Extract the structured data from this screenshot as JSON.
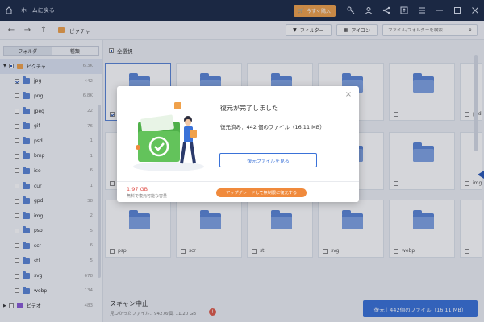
{
  "titlebar": {
    "home_label": "ホームに戻る",
    "buy_label": "今すぐ購入",
    "icons": [
      "cart-icon",
      "key-icon",
      "account-icon",
      "share-icon",
      "export-icon",
      "menu-icon",
      "minimize-icon",
      "maximize-icon",
      "close-icon"
    ]
  },
  "navbar": {
    "breadcrumb": "ピクチャ",
    "filter_label": "フィルター",
    "icon_view_label": "アイコン",
    "search_placeholder": "ファイル/フォルダーを検索"
  },
  "sidebar": {
    "tab_folder": "フォルダ",
    "tab_type": "種類",
    "root": {
      "label": "ピクチャ",
      "count": "6.3K"
    },
    "items": [
      {
        "label": "jpg",
        "count": "442",
        "checked": true
      },
      {
        "label": "png",
        "count": "6.8K",
        "checked": false
      },
      {
        "label": "jpeg",
        "count": "22",
        "checked": false
      },
      {
        "label": "gif",
        "count": "76",
        "checked": false
      },
      {
        "label": "psd",
        "count": "1",
        "checked": false
      },
      {
        "label": "bmp",
        "count": "1",
        "checked": false
      },
      {
        "label": "ico",
        "count": "6",
        "checked": false
      },
      {
        "label": "cur",
        "count": "1",
        "checked": false
      },
      {
        "label": "gpd",
        "count": "38",
        "checked": false
      },
      {
        "label": "img",
        "count": "2",
        "checked": false
      },
      {
        "label": "psp",
        "count": "5",
        "checked": false
      },
      {
        "label": "scr",
        "count": "6",
        "checked": false
      },
      {
        "label": "stl",
        "count": "5",
        "checked": false
      },
      {
        "label": "svg",
        "count": "678",
        "checked": false
      },
      {
        "label": "webp",
        "count": "134",
        "checked": false
      }
    ],
    "video": {
      "label": "ビデオ",
      "count": "483"
    }
  },
  "content": {
    "select_all": "全選択",
    "tiles": [
      {
        "label": "",
        "checked": true
      },
      {
        "label": "",
        "checked": false
      },
      {
        "label": "",
        "checked": false
      },
      {
        "label": "",
        "checked": false
      },
      {
        "label": "",
        "checked": false
      },
      {
        "label": "psd",
        "checked": false
      },
      {
        "label": "",
        "checked": false
      },
      {
        "label": "",
        "checked": false
      },
      {
        "label": "",
        "checked": false
      },
      {
        "label": "",
        "checked": false
      },
      {
        "label": "",
        "checked": false
      },
      {
        "label": "img",
        "checked": false
      },
      {
        "label": "psp",
        "checked": false
      },
      {
        "label": "scr",
        "checked": false
      },
      {
        "label": "stl",
        "checked": false
      },
      {
        "label": "svg",
        "checked": false
      },
      {
        "label": "webp",
        "checked": false
      },
      {
        "label": "",
        "checked": false
      }
    ]
  },
  "footer": {
    "scan_status": "スキャン中止",
    "found_info": "見つかったファイル：94276個, 11.20 GB",
    "recover_label": "復元｜442個のファイル（16.11 MB）"
  },
  "modal": {
    "title": "復元が完了しました",
    "recovered": "復元済み：442 個のファイル（16.11 MB）",
    "view_button": "復元ファイルを見る",
    "remaining_size": "1.97 GB",
    "remaining_label": "無料で復元可能な容量",
    "upgrade_button": "アップグレードして無制限に復元する"
  },
  "colors": {
    "titlebar": "#1d2b47",
    "accent": "#3a72d8",
    "orange": "#f08a3c",
    "folder": "#5b86d6"
  }
}
